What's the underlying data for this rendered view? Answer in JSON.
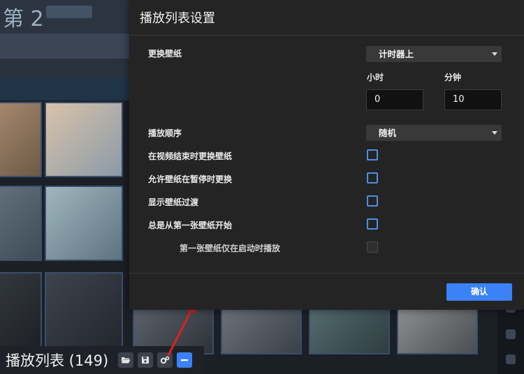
{
  "background": {
    "title_fragment": "第 2",
    "colors": {
      "app_bg": "#1b1f26",
      "tile_border": "#3a4f6c"
    }
  },
  "playlist_bar": {
    "title": "播放列表 (149)",
    "buttons": [
      {
        "icon": "folder-open-icon"
      },
      {
        "icon": "save-icon"
      },
      {
        "icon": "settings-cogs-icon"
      },
      {
        "icon": "minus-icon"
      }
    ]
  },
  "dialog": {
    "title": "播放列表设置",
    "change_wallpaper": {
      "label": "更换壁纸",
      "selected": "计时器上",
      "hours_label": "小时",
      "hours_value": "0",
      "minutes_label": "分钟",
      "minutes_value": "10"
    },
    "play_order": {
      "label": "播放顺序",
      "selected": "随机"
    },
    "options": [
      {
        "label": "在视频结束时更换壁纸",
        "checked": false
      },
      {
        "label": "允许壁纸在暂停时更换",
        "checked": false
      },
      {
        "label": "显示壁纸过渡",
        "checked": false
      },
      {
        "label": "总是从第一张壁纸开始",
        "checked": false
      }
    ],
    "sub_option": {
      "label": "第一张壁纸仅在启动时播放",
      "checked": false,
      "disabled": true
    },
    "confirm_label": "确认"
  },
  "colors": {
    "accent": "#3b82f6",
    "dialog_bg": "#242424",
    "arrow": "#e02020"
  }
}
